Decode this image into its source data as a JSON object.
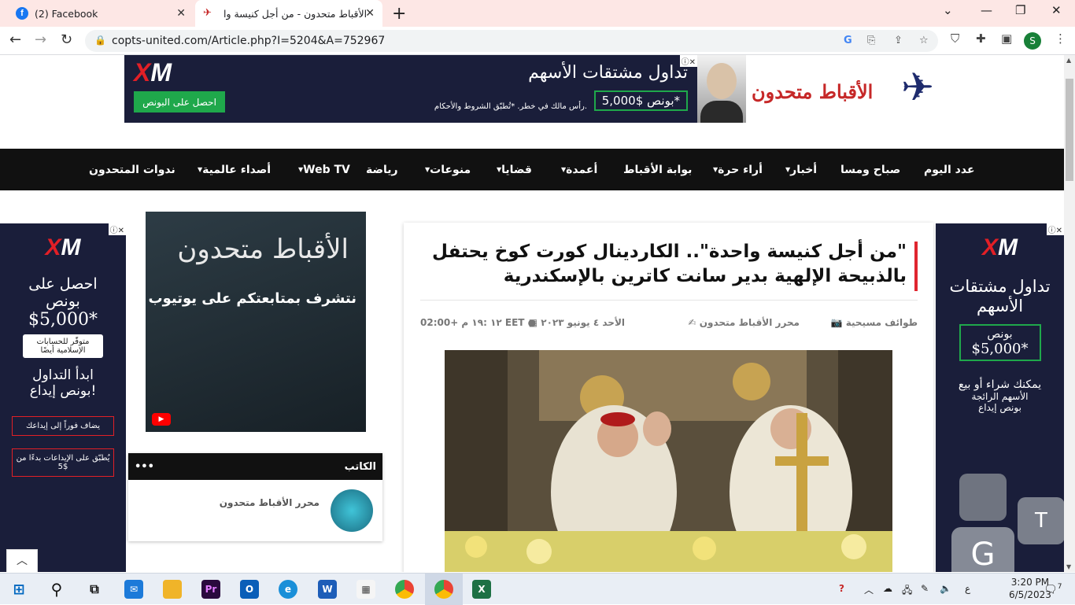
{
  "browser": {
    "tabs": [
      {
        "label": "(2) Facebook"
      },
      {
        "label": "الأقباط متحدون - من أجل كنيسة وا"
      }
    ],
    "new_tab": "+",
    "url": "copts-united.com/Article.php?I=5204&A=752967",
    "profile_initial": "S"
  },
  "top_ad": {
    "brand_x": "X",
    "brand_m": "M",
    "cta": "احصل على البونص",
    "headline": "تداول مشتقات الأسهم",
    "bonus": "بونص $5,000*",
    "disclaimer": "رأس مالك في خطر. *تُطبّق الشروط والأحكام."
  },
  "site": {
    "logo_text": "الأقباط متحدون"
  },
  "nav": {
    "items": [
      {
        "label": "عدد اليوم",
        "dropdown": false
      },
      {
        "label": "صباح ومسا",
        "dropdown": false
      },
      {
        "label": "أخبار",
        "dropdown": true
      },
      {
        "label": "أراء حرة",
        "dropdown": true
      },
      {
        "label": "بوابة الأقباط",
        "dropdown": false
      },
      {
        "label": "أعمدة",
        "dropdown": true
      },
      {
        "label": "قضايا",
        "dropdown": true
      },
      {
        "label": "منوعات",
        "dropdown": true
      },
      {
        "label": "رياضة",
        "dropdown": false
      },
      {
        "label": "Web TV",
        "dropdown": true
      },
      {
        "label": "أصداء عالمية",
        "dropdown": true
      },
      {
        "label": "ندوات المتحدون",
        "dropdown": false
      }
    ]
  },
  "left_ad": {
    "line1": "احصل على",
    "line2": "بونص",
    "bonus": "$5,000*",
    "islamic": "متوفّر للحسابات الإسلامية أيضًا",
    "start1": "ابدأ التداول",
    "start2": "بونص إيداع!",
    "feat1": "يضاف فوراً إلى إيداعك",
    "feat2": "يُطبّق على الإيداعات بدءًا من $5"
  },
  "right_ad": {
    "headline": "تداول مشتقات الأسهم",
    "bonus_label": "بونص",
    "bonus": "$5,000*",
    "sub1": "يمكنك شراء أو بيع",
    "sub2": "الأسهم الرائجة",
    "sub3": "بونص إيداع"
  },
  "youtube_box": {
    "title": "الأقباط متحدون",
    "subtitle": "نتشرف بمتابعتكم على يوتيوب"
  },
  "author_widget": {
    "header": "الكاتب",
    "dots": "•••",
    "author_name": "محرر الأقباط متحدون"
  },
  "article": {
    "title": "\"من أجل كنيسة واحدة\".. الكاردينال كورت كوخ يحتفل بالذبيحة الإلهية بدير سانت كاترين بالإسكندرية",
    "category": "طوائف مسيحية",
    "author": "محرر الأقباط متحدون",
    "date": "الأحد ٤ يونيو ٢٠٢٣",
    "time": "١٢ :١٩ م +02:00 EET"
  },
  "taskbar": {
    "time": "3:20 PM",
    "date": "6/5/2023",
    "lang": "ع",
    "notifications": "7"
  }
}
